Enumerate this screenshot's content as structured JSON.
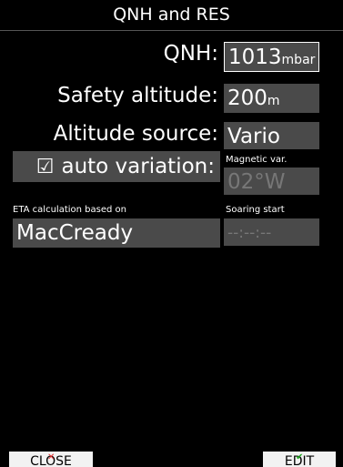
{
  "window": {
    "title": "QNH and RES"
  },
  "qnh": {
    "label": "QNH:",
    "value": "1013",
    "unit": "mbar"
  },
  "safety": {
    "label": "Safety altitude:",
    "value": "200",
    "unit": "m"
  },
  "altitude_source": {
    "label": "Altitude source:",
    "value": "Vario"
  },
  "magnetic": {
    "small_label": "Magnetic var.",
    "checkbox_glyph": "☑",
    "label": "auto variation:",
    "value": "02°W"
  },
  "eta": {
    "small_label": "ETA calculation based on",
    "value": "MacCready"
  },
  "soaring": {
    "small_label": "Soaring start",
    "value": "--:--:--"
  },
  "buttons": {
    "close_label": "CLOSE",
    "edit_label": "EDIT"
  },
  "colors": {
    "background": "#000000",
    "field": "#4a4a4a",
    "close_icon": "#e23030",
    "edit_icon": "#22aa22"
  }
}
